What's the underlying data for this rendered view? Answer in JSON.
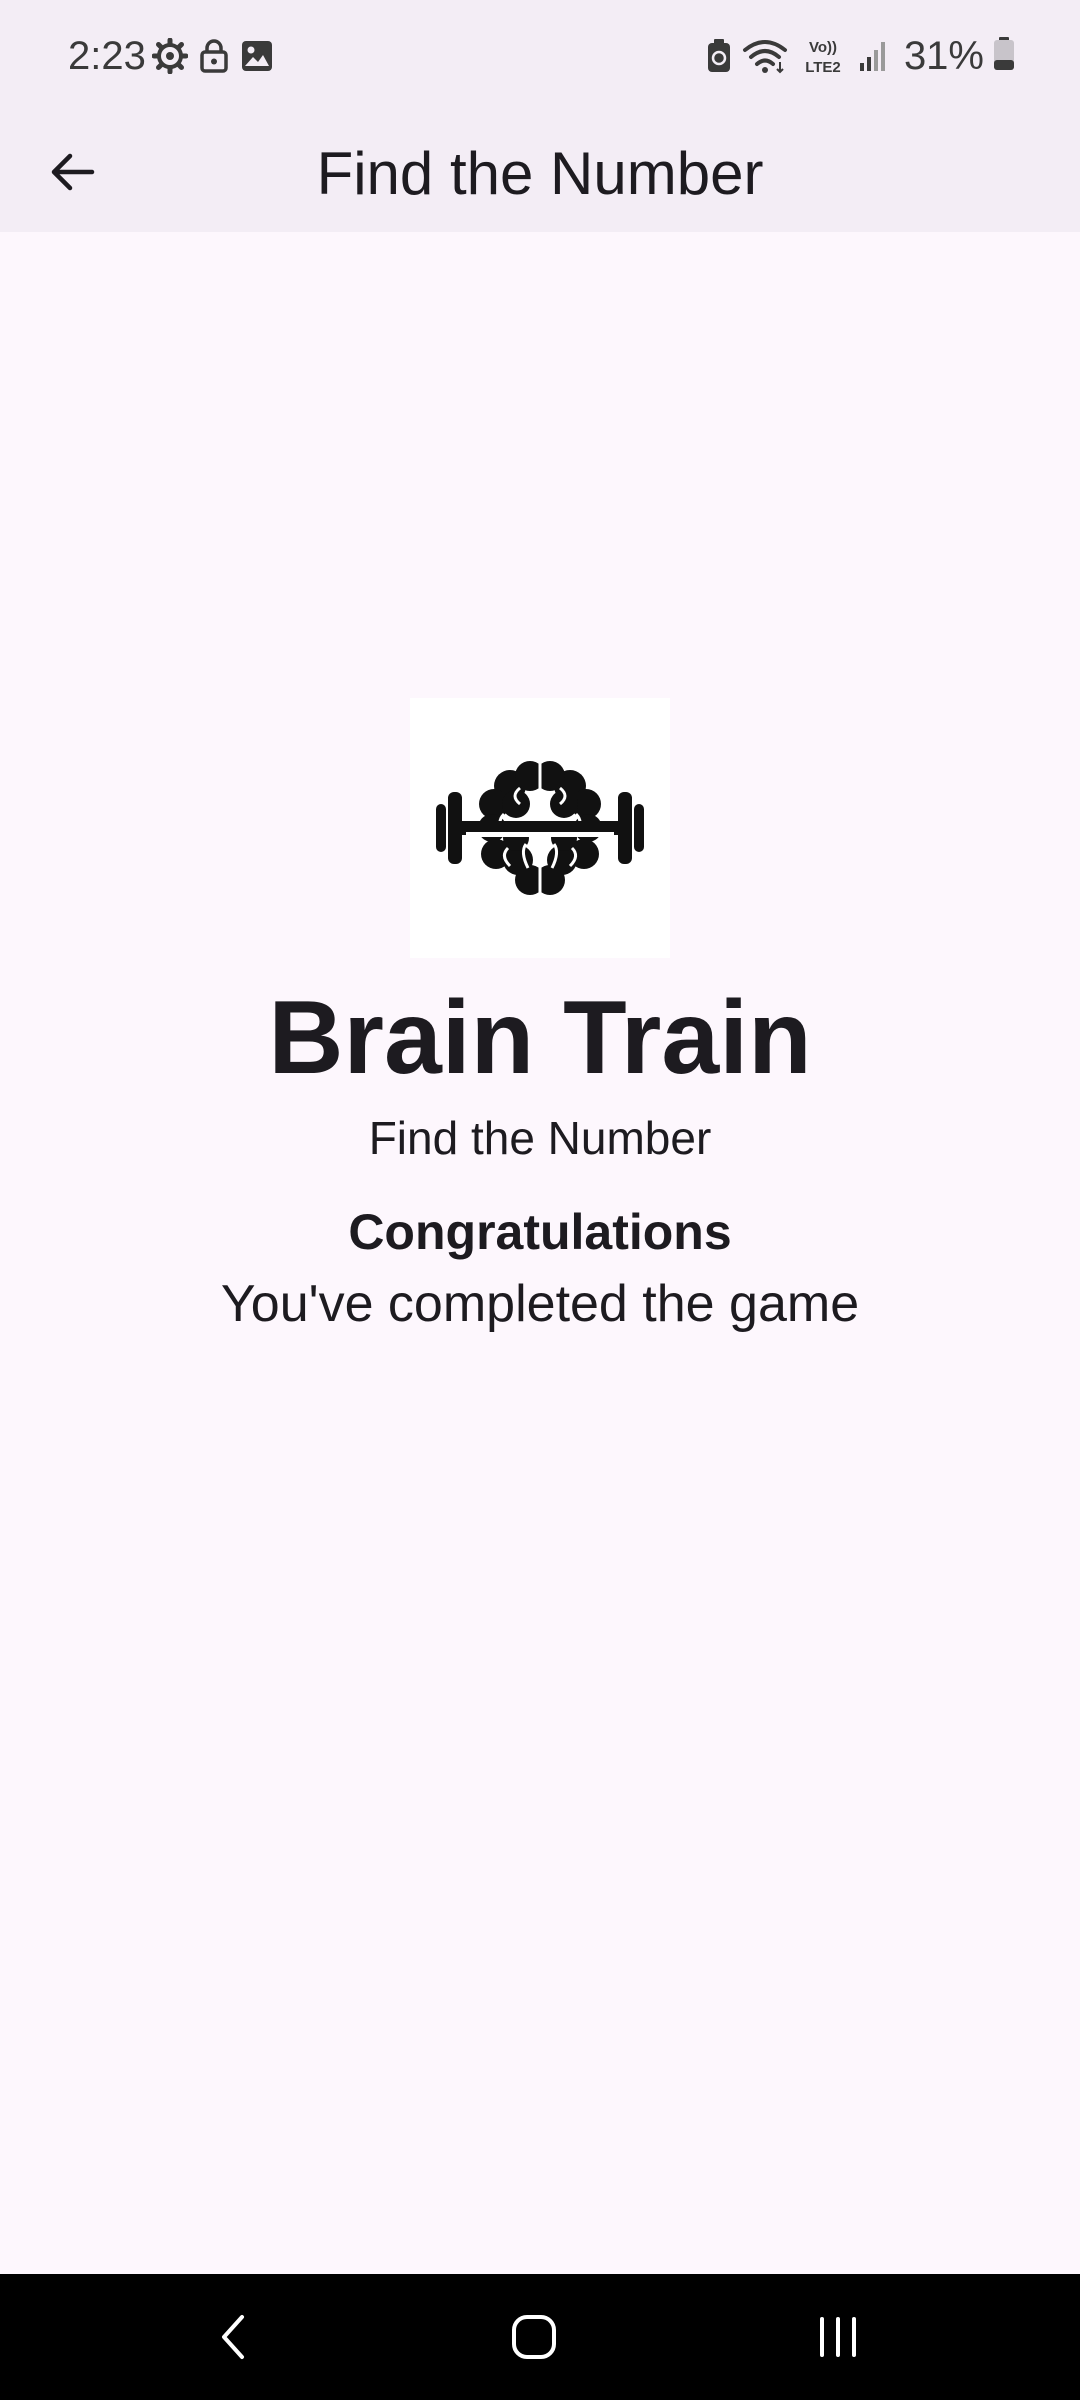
{
  "status_bar": {
    "time": "2:23",
    "battery": "31%",
    "icons_left": [
      "settings-gear-icon",
      "lock-icon",
      "image-icon"
    ],
    "icons_right": [
      "battery-saver-icon",
      "wifi-icon",
      "volte-lte2-icon",
      "cell-signal-icon",
      "battery-icon"
    ],
    "volte_label": "Vo))",
    "lte_label": "LTE2"
  },
  "app_bar": {
    "title": "Find the Number",
    "back_icon": "arrow-back-icon"
  },
  "main": {
    "logo_icon": "brain-dumbbell-icon",
    "brand_title": "Brain Train",
    "subtitle": "Find the Number",
    "congratulations": "Congratulations",
    "completed_message": "You've completed the game"
  },
  "nav_bar": {
    "icons": [
      "nav-back-icon",
      "nav-home-icon",
      "nav-recents-icon"
    ]
  },
  "colors": {
    "app_bar_bg": "#f3edf5",
    "content_bg": "#fdf7fd",
    "text": "#1d1b20",
    "nav_bar_bg": "#000000"
  }
}
